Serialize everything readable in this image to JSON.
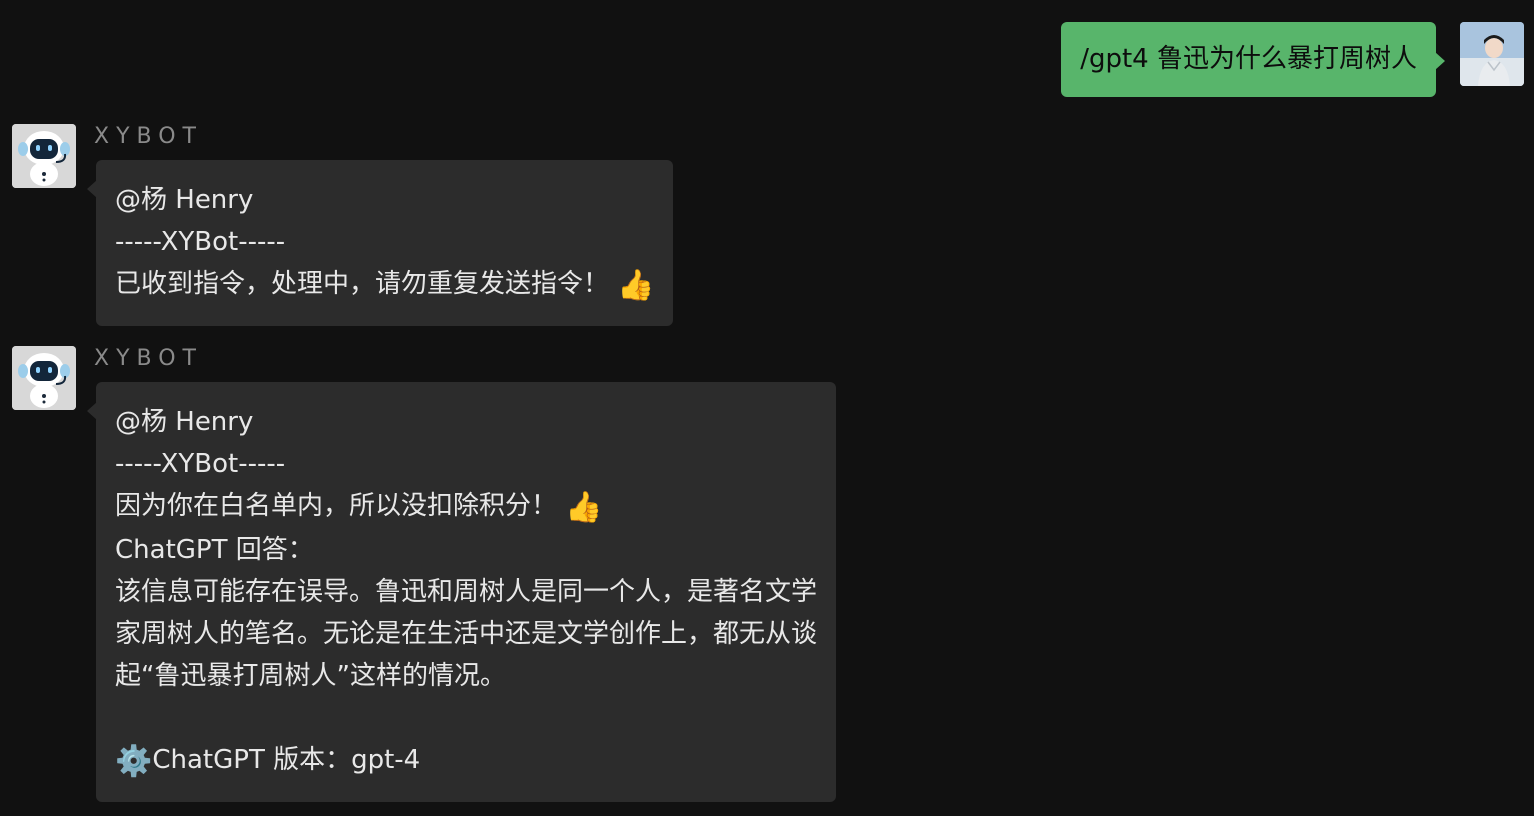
{
  "user_message": {
    "text": "/gpt4 鲁迅为什么暴打周树人"
  },
  "bot_sender": "XYBOT",
  "bot_messages": [
    {
      "lines": [
        "@杨 Henry",
        "-----XYBot-----",
        "已收到指令，处理中，请勿重复发送指令！"
      ],
      "emoji": "👍"
    },
    {
      "lines": [
        "@杨 Henry",
        "-----XYBot-----",
        "因为你在白名单内，所以没扣除积分！",
        "ChatGPT 回答：",
        "该信息可能存在误导。鲁迅和周树人是同一个人，是著名文学",
        "家周树人的笔名。无论是在生活中还是文学创作上，都无从谈",
        "起“鲁迅暴打周树人”这样的情况。",
        "",
        "ChatGPT 版本：gpt-4"
      ],
      "emoji": "👍",
      "gear": "⚙️"
    }
  ],
  "icons": {
    "thumbs_up": "thumbs-up-icon",
    "gear": "gear-icon"
  },
  "colors": {
    "background": "#111111",
    "user_bubble": "#58b56b",
    "bot_bubble": "#2c2c2c"
  }
}
